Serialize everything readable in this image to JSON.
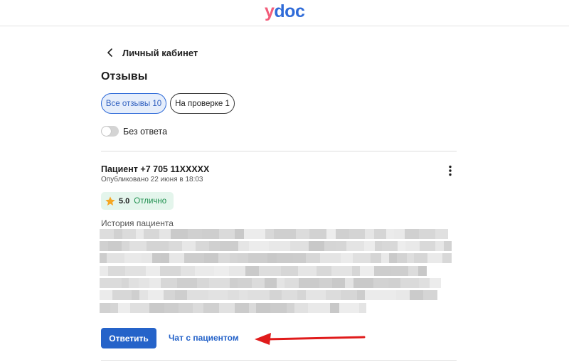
{
  "header": {
    "logo_first": "y",
    "logo_rest": "doc"
  },
  "nav": {
    "back_label": "Личный кабинет"
  },
  "page": {
    "title": "Отзывы"
  },
  "filters": {
    "all_label": "Все отзывы 10",
    "review_label": "На проверке 1",
    "unanswered_toggle_label": "Без ответа",
    "unanswered_toggle_on": false
  },
  "review": {
    "patient": "Пациент +7 705 11XXXXX",
    "published": "Опубликовано 22 июня в 18:03",
    "rating_value": "5.0",
    "rating_text": "Отлично",
    "story_label": "История пациента",
    "reply_label": "Ответить",
    "chat_label": "Чат с пациентом"
  },
  "colors": {
    "primary": "#2563c9",
    "chip_active_bg": "#e6eefb",
    "rating_bg": "#e4f5ec",
    "rating_text": "#1e8f4e",
    "star": "#f5a623",
    "annotation_arrow": "#e01b1b"
  },
  "icons": {
    "back": "chevron-left-icon",
    "more": "more-vertical-icon",
    "star": "star-icon"
  }
}
